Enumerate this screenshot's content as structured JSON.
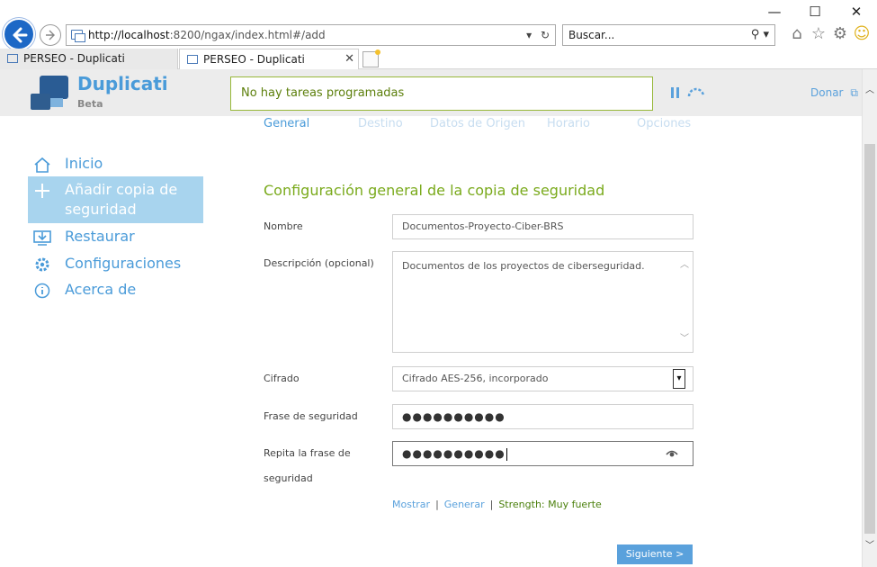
{
  "browser": {
    "window_controls": {
      "minimize": "—",
      "maximize": "☐",
      "close": "✕"
    },
    "address_host": "http://localhost",
    "address_rest": ":8200/ngax/index.html#/add",
    "search_placeholder": "Buscar...",
    "tabs": [
      {
        "label": "PERSEO - Duplicati",
        "active": false
      },
      {
        "label": "PERSEO - Duplicati",
        "active": true
      }
    ]
  },
  "app": {
    "name": "Duplicati",
    "subtitle": "Beta",
    "status": "No hay tareas programadas",
    "donate": "Donar"
  },
  "steps": [
    "General",
    "Destino",
    "Datos de Origen",
    "Horario",
    "Opciones"
  ],
  "sidebar": {
    "items": [
      {
        "label": "Inicio",
        "icon": "home-icon"
      },
      {
        "label": "Añadir copia de seguridad",
        "icon": "plus-icon",
        "active": true
      },
      {
        "label": "Restaurar",
        "icon": "restore-icon"
      },
      {
        "label": "Configuraciones",
        "icon": "gear-icon"
      },
      {
        "label": "Acerca de",
        "icon": "info-icon"
      }
    ]
  },
  "form": {
    "title": "Configuración general de la copia de seguridad",
    "name_label": "Nombre",
    "name_value": "Documentos-Proyecto-Ciber-BRS",
    "description_label": "Descripción (opcional)",
    "description_value": "Documentos de los proyectos de ciberseguridad.",
    "encryption_label": "Cifrado",
    "encryption_value": "Cifrado AES-256, incorporado",
    "passphrase_label": "Frase de seguridad",
    "passphrase_value": "●●●●●●●●●●",
    "repeat_label": "Repita la frase de seguridad",
    "repeat_value": "●●●●●●●●●●",
    "show_link": "Mostrar",
    "generate_link": "Generar",
    "strength": "Strength: Muy fuerte",
    "next_button": "Siguiente >"
  },
  "colors": {
    "accent": "#4a9bd9",
    "active_sidebar": "#a8d4ee",
    "title_green": "#7aaa1c",
    "status_green": "#5c7f0b"
  }
}
